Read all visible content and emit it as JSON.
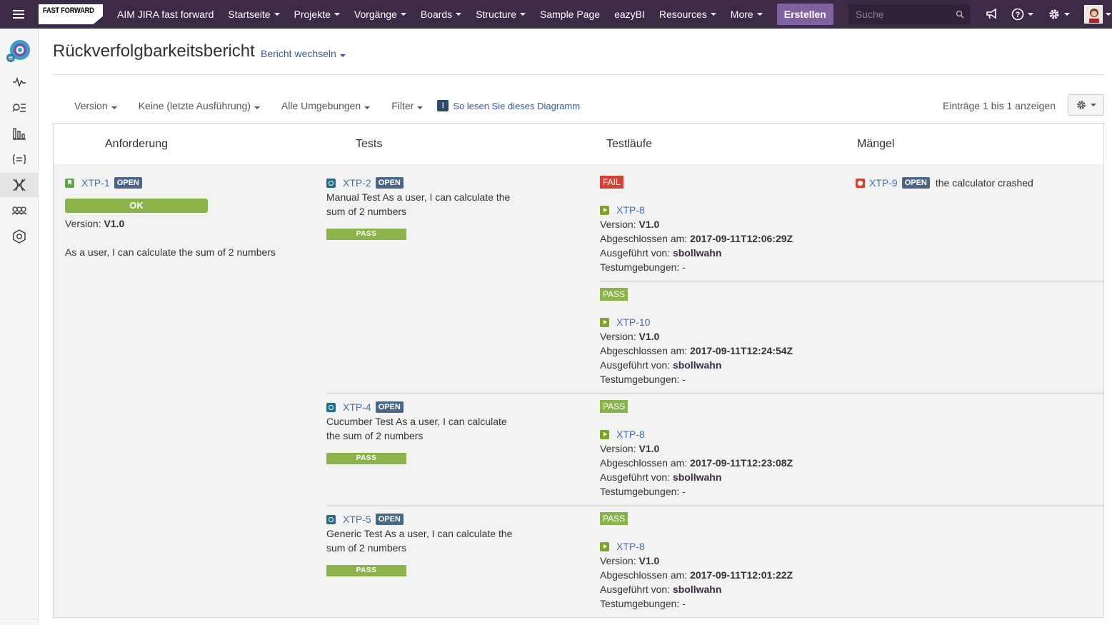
{
  "topbar": {
    "logo_text": "FAST FORWARD",
    "nav": [
      {
        "label": "AIM JIRA fast forward",
        "caret": false
      },
      {
        "label": "Startseite",
        "caret": true
      },
      {
        "label": "Projekte",
        "caret": true
      },
      {
        "label": "Vorgänge",
        "caret": true
      },
      {
        "label": "Boards",
        "caret": true
      },
      {
        "label": "Structure",
        "caret": true
      },
      {
        "label": "Sample Page",
        "caret": false
      },
      {
        "label": "eazyBI",
        "caret": false
      },
      {
        "label": "Resources",
        "caret": true
      },
      {
        "label": "More",
        "caret": true
      }
    ],
    "create_label": "Erstellen",
    "search_placeholder": "Suche",
    "colors": {
      "bar": "#3b2b47",
      "create": "#7e63a0"
    }
  },
  "page": {
    "title": "Rückverfolgbarkeitsbericht",
    "switch_report": "Bericht wechseln"
  },
  "filters": {
    "version": "Version",
    "execution": "Keine (letzte Ausführung)",
    "environments": "Alle Umgebungen",
    "filter": "Filter",
    "help": "So lesen Sie dieses Diagramm",
    "entries": "Einträge 1 bis 1 anzeigen"
  },
  "columns": {
    "requirement": "Anforderung",
    "tests": "Tests",
    "runs": "Testläufe",
    "defects": "Mängel"
  },
  "labels": {
    "version": "Version: ",
    "finished": "Abgeschlossen am: ",
    "executed_by": "Ausgeführt von: ",
    "environments": "Testumgebungen: "
  },
  "requirement": {
    "key": "XTP-1",
    "status": "OPEN",
    "coverage": "OK",
    "version_label": "Version: ",
    "version": "V1.0",
    "summary": "As a user, I can calculate the sum of 2 numbers"
  },
  "tests": [
    {
      "key": "XTP-2",
      "status": "OPEN",
      "summary": "Manual Test As a user, I can calculate the sum of 2 numbers",
      "result": "PASS"
    },
    {
      "key": "XTP-4",
      "status": "OPEN",
      "summary": "Cucumber Test As a user, I can calculate the sum of 2 numbers",
      "result": "PASS"
    },
    {
      "key": "XTP-5",
      "status": "OPEN",
      "summary": "Generic Test As a user, I can calculate the sum of 2 numbers",
      "result": "PASS"
    }
  ],
  "runs": [
    {
      "status": "FAIL",
      "key": "XTP-8",
      "version": "V1.0",
      "finished": "2017-09-11T12:06:29Z",
      "user": "sbollwahn",
      "env": "-"
    },
    {
      "status": "PASS",
      "key": "XTP-10",
      "version": "V1.0",
      "finished": "2017-09-11T12:24:54Z",
      "user": "sbollwahn",
      "env": "-"
    },
    {
      "status": "PASS",
      "key": "XTP-8",
      "version": "V1.0",
      "finished": "2017-09-11T12:23:08Z",
      "user": "sbollwahn",
      "env": "-"
    },
    {
      "status": "PASS",
      "key": "XTP-8",
      "version": "V1.0",
      "finished": "2017-09-11T12:01:22Z",
      "user": "sbollwahn",
      "env": "-"
    }
  ],
  "defects": [
    {
      "key": "XTP-9",
      "status": "OPEN",
      "summary": "the calculator crashed"
    }
  ]
}
